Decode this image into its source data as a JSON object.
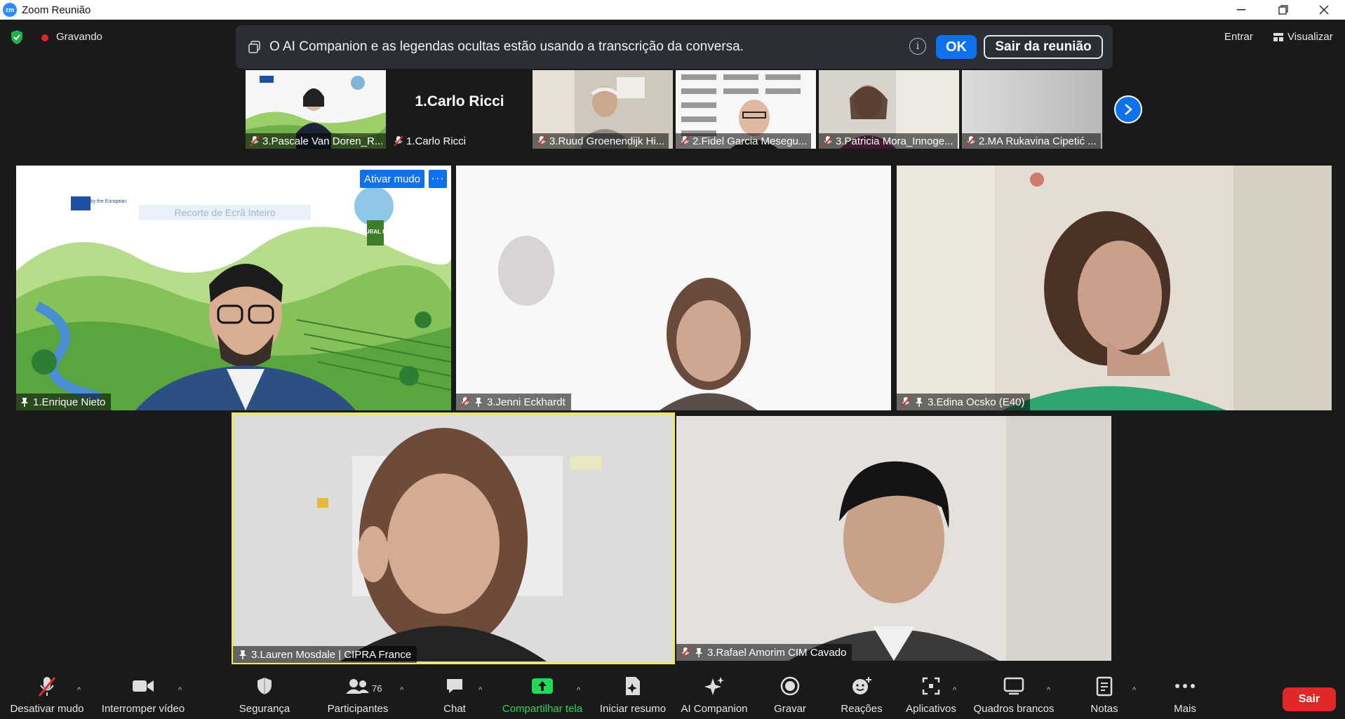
{
  "window": {
    "title": "Zoom Reunião",
    "logo_text": "zm"
  },
  "status": {
    "recording_label": "Gravando",
    "entrar_label": "Entrar",
    "visualizar_label": "Visualizar"
  },
  "notice": {
    "message": "O AI Companion e as legendas ocultas estão usando a transcrição da conversa.",
    "ok_label": "OK",
    "leave_label": "Sair da reunião"
  },
  "thumbnails": [
    {
      "name": "3.Pascale Van Doren_R...",
      "muted": true
    },
    {
      "name": "1.Carlo Ricci",
      "card_text": "1.Carlo Ricci",
      "muted": true
    },
    {
      "name": "3.Ruud Groenendijk Hi...",
      "muted": true
    },
    {
      "name": "2.Fidel Garcia Mesegu...",
      "muted": true
    },
    {
      "name": "3.Patricia Mora_Innoge...",
      "muted": true
    },
    {
      "name": "2.MA Rukavina Cipetić ...",
      "muted": true
    }
  ],
  "tiles": [
    {
      "name": "1.Enrique Nieto",
      "muted": false,
      "pinned": true,
      "ativar_label": "Ativar mudo",
      "slide_banner": "Funded by the European Union",
      "slide_caption": "Recorte de Ecrã Inteiro",
      "slide_logo": "RURAL PACT"
    },
    {
      "name": "3.Jenni Eckhardt",
      "muted": true,
      "pinned": true
    },
    {
      "name": "3.Edina Ocsko (E40)",
      "muted": true,
      "pinned": true
    },
    {
      "name": "3.Lauren Mosdale | CIPRA France",
      "muted": false,
      "pinned": true,
      "active_speaker": true
    },
    {
      "name": "3.Rafael Amorim CIM Cavado",
      "muted": true,
      "pinned": true
    }
  ],
  "toolbar": {
    "items": [
      {
        "label": "Desativar mudo",
        "icon": "microphone-muted-icon"
      },
      {
        "label": "Interromper vídeo",
        "icon": "video-camera-icon"
      },
      {
        "label": "Segurança",
        "icon": "shield-icon"
      },
      {
        "label": "Participantes",
        "icon": "participants-icon",
        "count": "76"
      },
      {
        "label": "Chat",
        "icon": "chat-icon"
      },
      {
        "label": "Compartilhar tela",
        "icon": "share-screen-icon"
      },
      {
        "label": "Iniciar resumo",
        "icon": "summary-icon"
      },
      {
        "label": "AI Companion",
        "icon": "sparkle-icon"
      },
      {
        "label": "Gravar",
        "icon": "record-icon"
      },
      {
        "label": "Reações",
        "icon": "reaction-icon"
      },
      {
        "label": "Aplicativos",
        "icon": "apps-icon"
      },
      {
        "label": "Quadros brancos",
        "icon": "whiteboard-icon"
      },
      {
        "label": "Notas",
        "icon": "notes-icon"
      },
      {
        "label": "Mais",
        "icon": "more-icon"
      }
    ],
    "leave_label": "Sair"
  },
  "colors": {
    "accent": "#0e72ed",
    "leave": "#e02828",
    "share_green": "#23d959",
    "speaker_border": "#e8e67a"
  }
}
